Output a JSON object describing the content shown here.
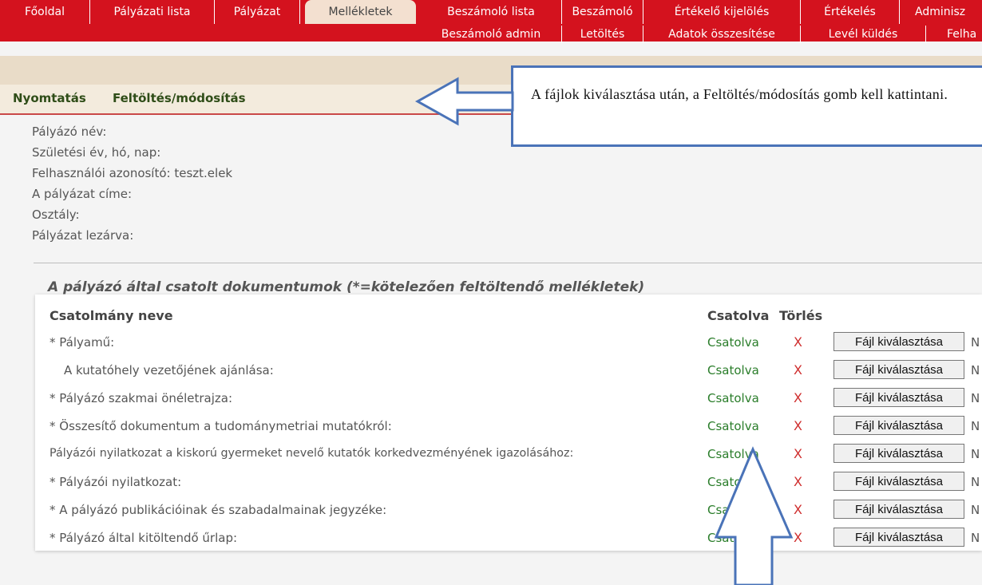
{
  "nav": {
    "row1": [
      "Főoldal",
      "Pályázati lista",
      "Pályázat",
      "Mellékletek",
      "Beszámoló lista",
      "Beszámoló",
      "Értékelő kijelölés",
      "Értékelés",
      "Adminisz"
    ],
    "row2": [
      "Beszámoló admin",
      "Letöltés",
      "Adatok összesítése",
      "Levél küldés",
      "Felha"
    ]
  },
  "actions": {
    "print": "Nyomtatás",
    "upload": "Feltöltés/módosítás"
  },
  "info": [
    "Pályázó név:",
    "Születési év, hó, nap:",
    "Felhasználói azonosító: teszt.elek",
    "A pályázat címe:",
    "Osztály:",
    "Pályázat lezárva:"
  ],
  "attachments": {
    "title": "A pályázó által csatolt dokumentumok (*=kötelezően feltöltendő mellékletek)",
    "col_name": "Csatolmány neve",
    "col_attached": "Csatolva",
    "col_delete": "Törlés",
    "file_button": "Fájl kiválasztása",
    "trunc": "N",
    "rows": [
      {
        "name": "* Pályamű:",
        "status": "Csatolva",
        "delete": "X"
      },
      {
        "name": "A kutatóhely vezetőjének ajánlása:",
        "status": "Csatolva",
        "delete": "X"
      },
      {
        "name": "* Pályázó szakmai önéletrajza:",
        "status": "Csatolva",
        "delete": "X"
      },
      {
        "name": "* Összesítő dokumentum a tudománymetriai mutatókról:",
        "status": "Csatolva",
        "delete": "X"
      },
      {
        "name": "Pályázói nyilatkozat a kiskorú gyermeket nevelő kutatók korkedvezményének igazolásához:",
        "status": "Csatolva",
        "delete": "X"
      },
      {
        "name": "* Pályázói nyilatkozat:",
        "status": "Csatolva",
        "delete": "X"
      },
      {
        "name": "* A pályázó publikációinak és szabadalmainak jegyzéke:",
        "status": "Csatolva",
        "delete": "X"
      },
      {
        "name": "* Pályázó által kitöltendő űrlap:",
        "status": "Csatolva",
        "delete": "X"
      }
    ]
  },
  "callout": {
    "text": "A fájlok kiválasztása után, a Feltöltés/módosítás gomb kell kattintani."
  },
  "colors": {
    "nav_red": "#d4121e",
    "arrow_blue": "#4a73b8",
    "attached_green": "#2a7d2a",
    "delete_red": "#cf2e2e"
  }
}
